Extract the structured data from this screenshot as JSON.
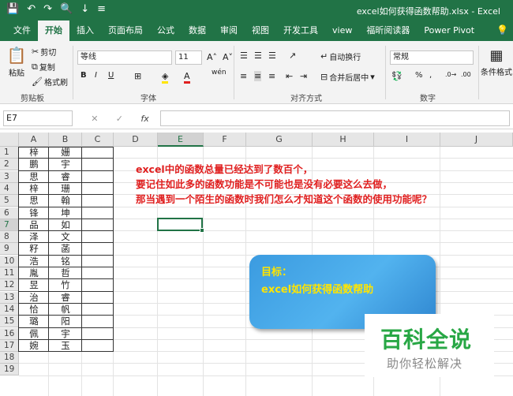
{
  "title_bar": {
    "window_title": "excel如何获得函数帮助.xlsx  -  Excel"
  },
  "tabs": [
    "文件",
    "开始",
    "插入",
    "页面布局",
    "公式",
    "数据",
    "审阅",
    "视图",
    "开发工具",
    "view",
    "福昕阅读器",
    "Power Pivot"
  ],
  "active_tab": "开始",
  "ribbon": {
    "clipboard": {
      "paste": "粘贴",
      "cut": "剪切",
      "copy": "复制",
      "format_painter": "格式刷",
      "label": "剪贴板"
    },
    "font": {
      "name": "等线",
      "size": "11",
      "bold": "B",
      "italic": "I",
      "underline": "U",
      "label": "字体",
      "phonetic": "wén"
    },
    "alignment": {
      "wrap": "自动换行",
      "merge": "合并后居中",
      "label": "对齐方式"
    },
    "number": {
      "format": "常规",
      "percent": "%",
      "comma": ",",
      "label": "数字"
    },
    "styles": {
      "conditional": "条件格式"
    }
  },
  "formula_bar": {
    "name_box": "E7",
    "fx": "fx",
    "formula": ""
  },
  "grid": {
    "columns": [
      "A",
      "B",
      "C",
      "D",
      "E",
      "F",
      "G",
      "H",
      "I",
      "J"
    ],
    "rows": [
      "1",
      "2",
      "3",
      "4",
      "5",
      "6",
      "7",
      "8",
      "9",
      "10",
      "11",
      "12",
      "13",
      "14",
      "15",
      "16",
      "17",
      "18",
      "19"
    ],
    "selected_col": "E",
    "selected_row": "7",
    "data": [
      [
        "梓",
        "姗"
      ],
      [
        "鹏",
        "宇"
      ],
      [
        "思",
        "睿"
      ],
      [
        "梓",
        "珊"
      ],
      [
        "思",
        "翰"
      ],
      [
        "锋",
        "坤"
      ],
      [
        "品",
        "如"
      ],
      [
        "泽",
        "文"
      ],
      [
        "籽",
        "菡"
      ],
      [
        "浩",
        "铭"
      ],
      [
        "胤",
        "哲"
      ],
      [
        "昱",
        "竹"
      ],
      [
        "治",
        "睿"
      ],
      [
        "恰",
        "帆"
      ],
      [
        "璐",
        "阳"
      ],
      [
        "佩",
        "宇"
      ],
      [
        "婉",
        "玉"
      ]
    ]
  },
  "annotation": [
    "excel中的函数总量已经达到了数百个，",
    "要记住如此多的函数功能是不可能也是没有必要这么去做，",
    "那当遇到一个陌生的函数时我们怎么才知道这个函数的使用功能呢？"
  ],
  "callout": {
    "line1": "目标：",
    "line2": "excel如何获得函数帮助"
  },
  "watermark": {
    "line1": "百科全说",
    "line2": "助你轻松解决"
  },
  "colors": {
    "accent": "#217346",
    "annotation": "#e02020",
    "callout_text": "#ffe500",
    "watermark": "#28a745"
  }
}
